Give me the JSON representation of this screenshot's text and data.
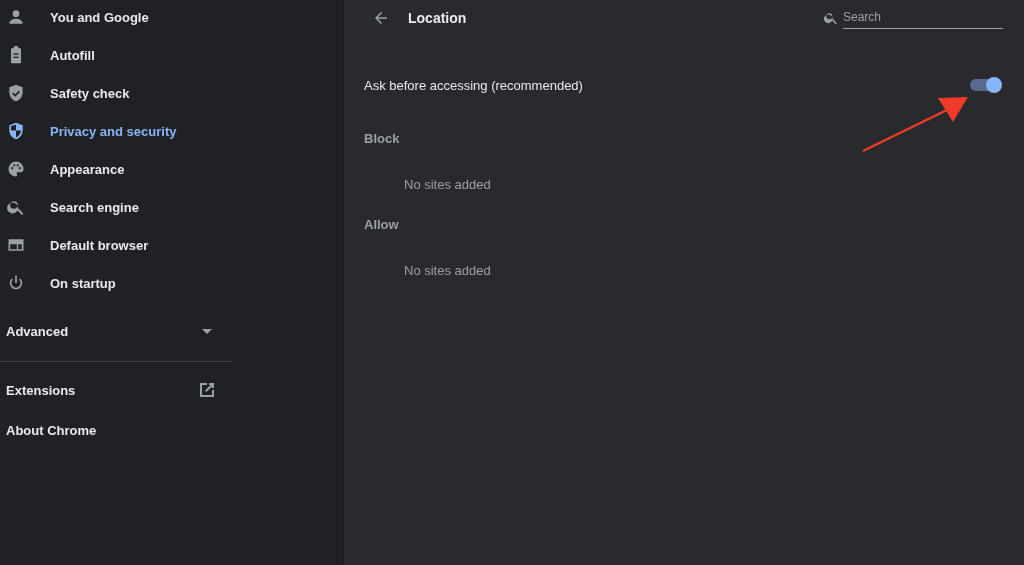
{
  "sidebar": {
    "items": [
      {
        "label": "You and Google",
        "selected": false
      },
      {
        "label": "Autofill",
        "selected": false
      },
      {
        "label": "Safety check",
        "selected": false
      },
      {
        "label": "Privacy and security",
        "selected": true
      },
      {
        "label": "Appearance",
        "selected": false
      },
      {
        "label": "Search engine",
        "selected": false
      },
      {
        "label": "Default browser",
        "selected": false
      },
      {
        "label": "On startup",
        "selected": false
      }
    ],
    "advanced": {
      "label": "Advanced",
      "expanded": false
    },
    "links": [
      {
        "label": "Extensions",
        "kind": "external"
      },
      {
        "label": "About Chrome",
        "kind": "plain"
      }
    ]
  },
  "header": {
    "title": "Location",
    "search": {
      "placeholder": "Search"
    }
  },
  "setting": {
    "label": "Ask before accessing (recommended)",
    "on": true
  },
  "sections": [
    {
      "heading": "Block",
      "empty_text": "No sites added"
    },
    {
      "heading": "Allow",
      "empty_text": "No sites added"
    }
  ]
}
